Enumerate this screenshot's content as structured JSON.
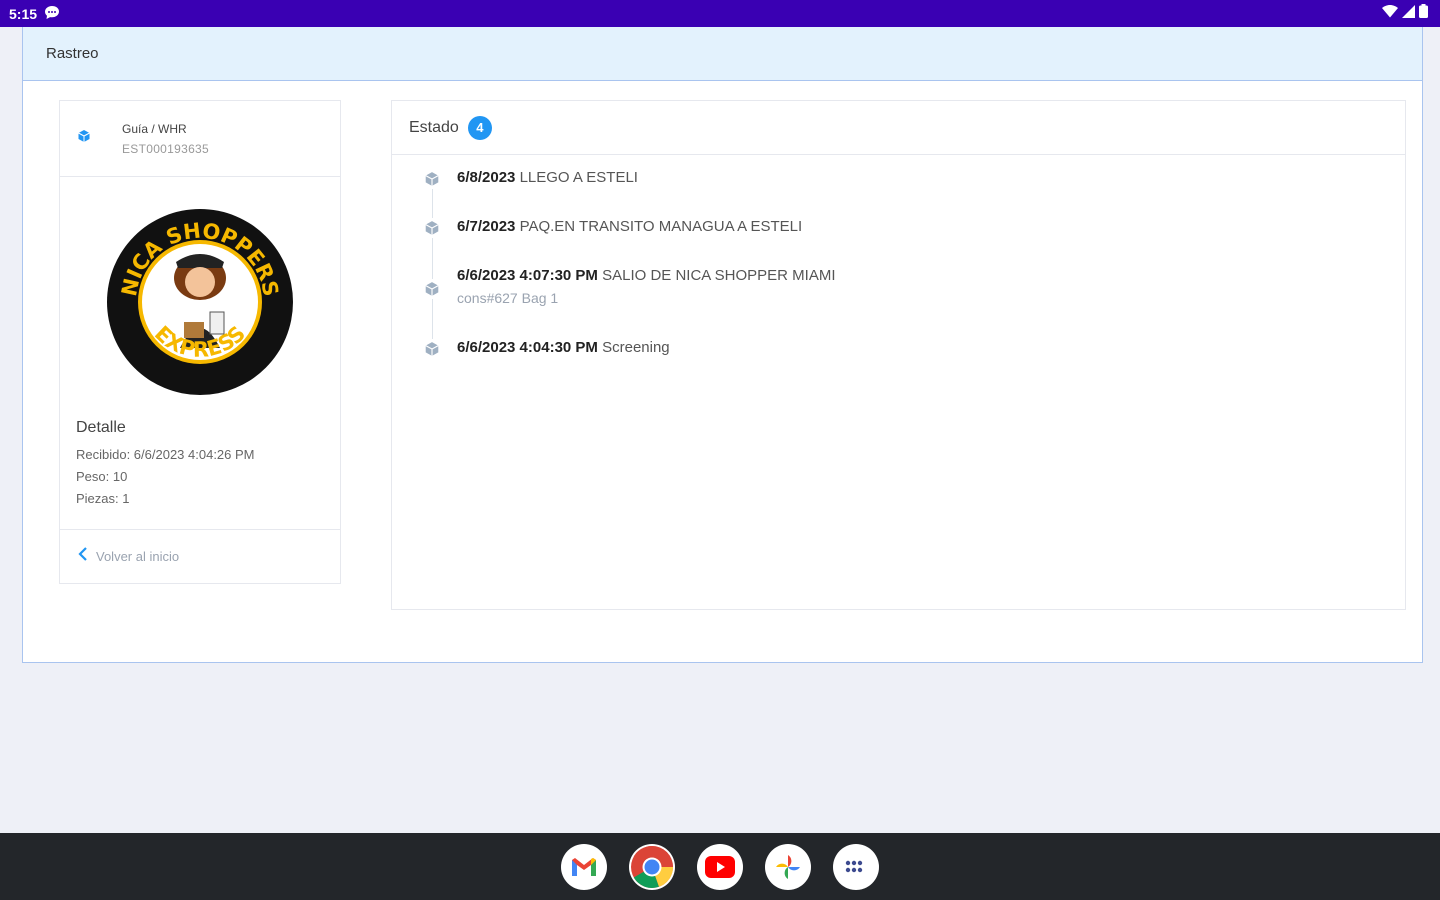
{
  "statusbar": {
    "time": "5:15"
  },
  "header": {
    "title": "Rastreo"
  },
  "left": {
    "guia_title": "Guía / WHR",
    "guia_code": "EST000193635",
    "logo": {
      "top_text": "NICA SHOPPERS",
      "bottom_text": "EXPRESS"
    },
    "detalle_title": "Detalle",
    "recibido": "Recibido: 6/6/2023 4:04:26 PM",
    "peso": "Peso: 10",
    "piezas": "Piezas: 1",
    "back_label": "Volver al inicio"
  },
  "estado": {
    "title": "Estado",
    "count": "4",
    "events": [
      {
        "date": "6/8/2023",
        "desc": "LLEGO A ESTELI",
        "sub": ""
      },
      {
        "date": "6/7/2023",
        "desc": "PAQ.EN TRANSITO MANAGUA A ESTELI",
        "sub": ""
      },
      {
        "date": "6/6/2023 4:07:30 PM",
        "desc": "SALIO DE NICA SHOPPER MIAMI",
        "sub": "cons#627 Bag 1"
      },
      {
        "date": "6/6/2023 4:04:30 PM",
        "desc": "Screening",
        "sub": ""
      }
    ]
  },
  "dock": {
    "apps": [
      "gmail-icon",
      "chrome-icon",
      "youtube-icon",
      "photos-icon",
      "app-drawer-icon"
    ]
  },
  "colors": {
    "statusbar": "#3a00b3",
    "header_bg": "#e3f2fd",
    "accent": "#2196f3",
    "dock": "#23262a"
  }
}
